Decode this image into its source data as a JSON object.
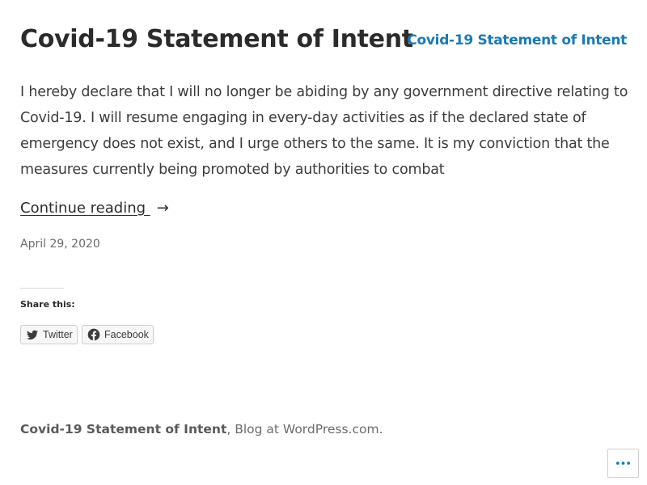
{
  "header": {
    "post_title": "Covid-19 Statement of Intent",
    "site_title": "Covid-19 Statement of Intent"
  },
  "post": {
    "excerpt": "I hereby declare that I will no longer be abiding by any government directive relating to Covid-19. I will resume engaging in every-day activities as if the declared state of emergency does not exist, and I urge others to the same. It is my conviction that the measures currently being promoted by authorities to combat",
    "continue_label": "Continue reading",
    "continue_arrow": "→",
    "date": "April 29, 2020"
  },
  "share": {
    "heading": "Share this:",
    "buttons": [
      {
        "label": "Twitter",
        "icon": "twitter-icon"
      },
      {
        "label": "Facebook",
        "icon": "facebook-icon"
      }
    ]
  },
  "footer": {
    "site_link": "Covid-19 Statement of Intent",
    "separator": ", ",
    "blog_link": "Blog at WordPress.com",
    "end": "."
  },
  "actions": {
    "icon": "ellipsis-icon"
  },
  "colors": {
    "accent": "#1a7ab8",
    "text": "#2b2b2b",
    "muted": "#6b6b6b"
  }
}
